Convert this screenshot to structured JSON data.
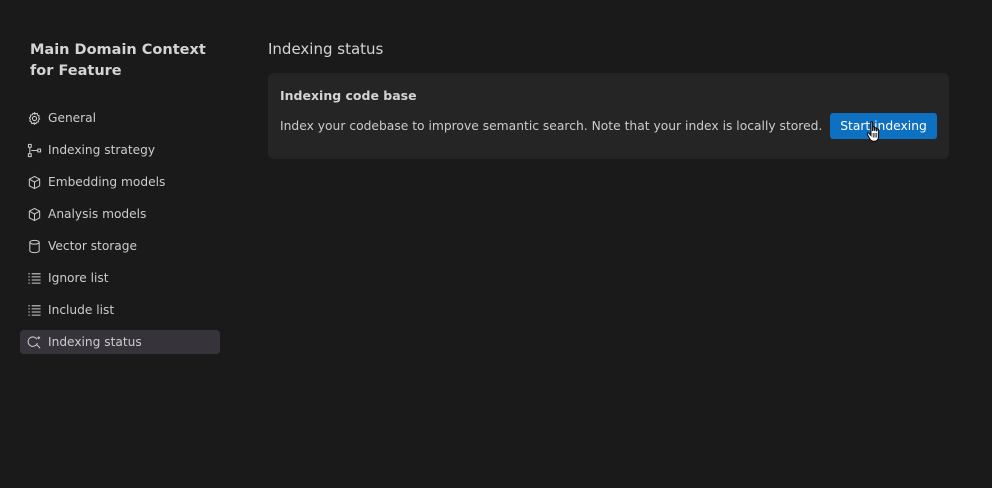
{
  "sidebar": {
    "title": "Main Domain Context for Feature",
    "items": [
      {
        "label": "General",
        "icon": "gear-icon"
      },
      {
        "label": "Indexing strategy",
        "icon": "strategy-icon"
      },
      {
        "label": "Embedding models",
        "icon": "cube-icon"
      },
      {
        "label": "Analysis models",
        "icon": "cube-icon"
      },
      {
        "label": "Vector storage",
        "icon": "database-icon"
      },
      {
        "label": "Ignore list",
        "icon": "list-icon"
      },
      {
        "label": "Include list",
        "icon": "list-icon"
      },
      {
        "label": "Indexing status",
        "icon": "search-sparkle-icon",
        "active": true
      }
    ]
  },
  "main": {
    "title": "Indexing status",
    "card": {
      "title": "Indexing code base",
      "description": "Index your codebase to improve semantic search. Note that your index is locally stored.",
      "button_label": "Start indexing"
    }
  },
  "colors": {
    "background": "#1a1a1b",
    "card": "#252526",
    "active_item": "#37333b",
    "button": "#0e70c0"
  }
}
